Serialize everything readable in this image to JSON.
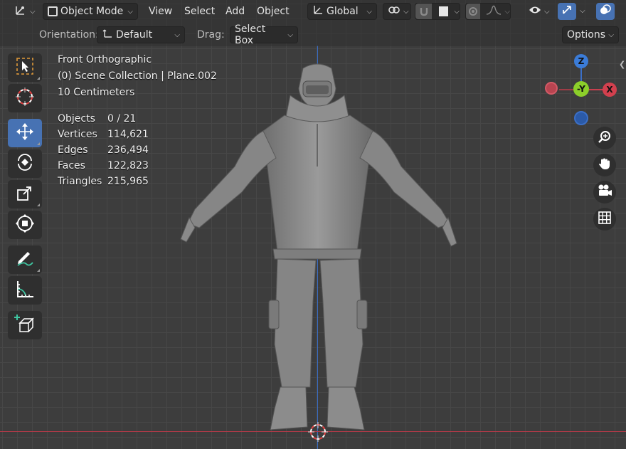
{
  "header": {
    "editor_type_icon": "axes-gizmo-icon",
    "mode": "Object Mode",
    "menus": [
      "View",
      "Select",
      "Add",
      "Object"
    ],
    "transform_orientation": "Global"
  },
  "toolbar2": {
    "orientation_label": "Orientation:",
    "orientation_value": "Default",
    "drag_label": "Drag:",
    "drag_value": "Select Box",
    "options_label": "Options"
  },
  "overlay": {
    "view_name": "Front Orthographic",
    "collection": "(0) Scene Collection | Plane.002",
    "scale": "10 Centimeters"
  },
  "stats": [
    {
      "label": "Objects",
      "value": "0 / 21"
    },
    {
      "label": "Vertices",
      "value": "114,621"
    },
    {
      "label": "Edges",
      "value": "236,494"
    },
    {
      "label": "Faces",
      "value": "122,823"
    },
    {
      "label": "Triangles",
      "value": "215,965"
    }
  ],
  "gizmo": {
    "z": "Z",
    "y": "-Y",
    "x": "X"
  },
  "colors": {
    "accent": "#4772b3",
    "x_axis": "#b43a48",
    "y_axis": "#7fbf26",
    "z_axis": "#3b6fc7"
  }
}
